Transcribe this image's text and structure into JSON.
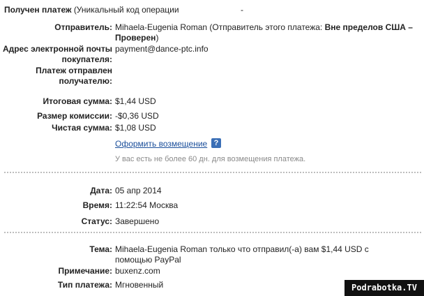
{
  "header": {
    "label": "Получен платеж",
    "detail": "(Уникальный код операции",
    "dash": "-"
  },
  "sender": {
    "label": "Отправитель:",
    "name": "Mihaela-Eugenia Roman",
    "status_prefix": "(Отправитель этого платежа:",
    "status_bold_1": "Вне пределов США –",
    "status_bold_2": "Проверен",
    "status_suffix": ")"
  },
  "buyer_email": {
    "label_line1": "Адрес электронной почты",
    "label_line2": "покупателя:",
    "value": "payment@dance-ptc.info"
  },
  "sent_to": {
    "label_line1": "Платеж отправлен",
    "label_line2": "получателю:"
  },
  "amounts": {
    "total_label": "Итоговая сумма:",
    "total_value": "$1,44 USD",
    "fee_label": "Размер комиссии:",
    "fee_value": "-$0,36 USD",
    "net_label": "Чистая сумма:",
    "net_value": "$1,08 USD"
  },
  "refund": {
    "link_label": "Оформить возмещение",
    "help_icon_glyph": "?",
    "note": "У вас есть не более 60 дн. для возмещения платежа."
  },
  "details": {
    "date_label": "Дата:",
    "date_value": "05 апр 2014",
    "time_label": "Время:",
    "time_value": "11:22:54 Москва",
    "status_label": "Статус:",
    "status_value": "Завершено"
  },
  "message": {
    "subject_label": "Тема:",
    "subject_line1": "Mihaela-Eugenia Roman только что отправил(-а) вам $1,44 USD с",
    "subject_line2": "помощью PayPal",
    "note_label": "Примечание:",
    "note_value": "buxenz.com",
    "type_label": "Тип платежа:",
    "type_value": "Мгновенный"
  },
  "watermark": "Podrabotka.TV",
  "colors": {
    "link": "#1b4f9b",
    "help_icon_bg": "#3b6fb6",
    "note_text": "#8a8a8a",
    "divider": "#bdbdbd"
  }
}
